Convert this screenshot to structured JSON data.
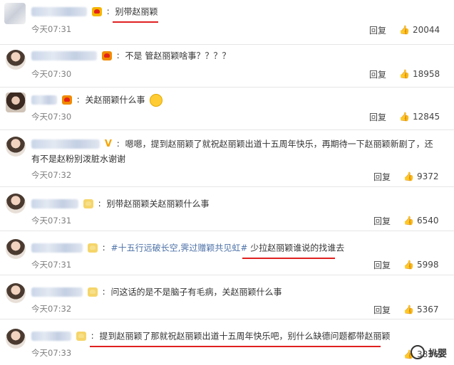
{
  "comments": [
    {
      "name": "",
      "text": "别带赵丽颖",
      "time": "今天07:31",
      "reply": "回复",
      "likes": "20044"
    },
    {
      "name": "",
      "text": "不是 管赵丽颖啥事？？？？",
      "time": "今天07:30",
      "reply": "回复",
      "likes": "18958"
    },
    {
      "name": "",
      "text": "关赵丽颖什么事",
      "time": "今天07:30",
      "reply": "回复",
      "likes": "12845"
    },
    {
      "name": "",
      "text": "嗯嗯，提到赵丽颖了就祝赵丽颖出道十五周年快乐，再期待一下赵丽颖新剧了，还",
      "text2": "有不是赵粉别泼脏水谢谢",
      "time": "今天07:32",
      "reply": "回复",
      "likes": "9372"
    },
    {
      "name": "",
      "text": "别带赵丽颖关赵丽颖什么事",
      "time": "今天07:31",
      "reply": "回复",
      "likes": "6540"
    },
    {
      "name": "",
      "topic": "#十五行远破长空,霁过赠颖共见虹#",
      "text": "少拉赵丽颖谁说的找谁去",
      "time": "今天07:31",
      "reply": "回复",
      "likes": "5998"
    },
    {
      "name": "",
      "text": "问这话的是不是脑子有毛病，关赵丽颖什么事",
      "time": "今天07:32",
      "reply": "回复",
      "likes": "5367"
    },
    {
      "name": "",
      "text": "提到赵丽颖了那就祝赵丽颖出道十五周年快乐吧，别什么缺德问题都带赵丽颖",
      "time": "今天07:33",
      "reply": "回复",
      "likes": "3836"
    }
  ],
  "watermark": "扒婴",
  "icons": {
    "like": "thumbs-up-icon",
    "badge": "crown-badge-icon"
  },
  "colors": {
    "highlight": "#e02020",
    "topic": "#4d72a8",
    "vip": "#f5a400"
  }
}
